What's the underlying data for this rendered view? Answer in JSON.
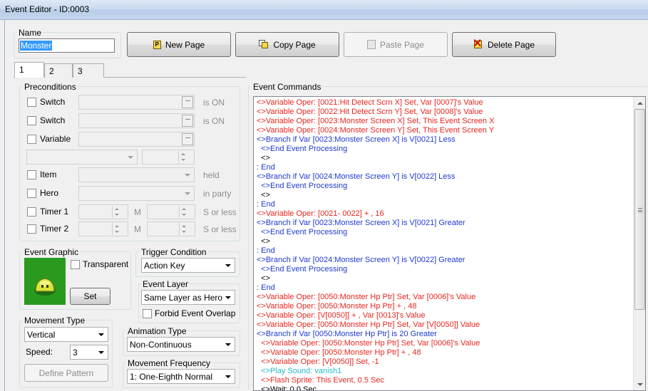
{
  "window": {
    "title": "Event Editor - ID:0003"
  },
  "name_group": {
    "label": "Name",
    "value": "Monster"
  },
  "toolbar": {
    "new_page": "New Page",
    "copy_page": "Copy Page",
    "paste_page": "Paste Page",
    "delete_page": "Delete Page"
  },
  "tabs": [
    "1",
    "2",
    "3"
  ],
  "preconditions": {
    "label": "Preconditions",
    "switch1": {
      "label": "Switch",
      "suffix": "is ON"
    },
    "switch2": {
      "label": "Switch",
      "suffix": "is ON"
    },
    "variable": {
      "label": "Variable"
    },
    "item": {
      "label": "Item",
      "suffix": "held"
    },
    "hero": {
      "label": "Hero",
      "suffix": "in party"
    },
    "timer1": {
      "label": "Timer 1",
      "m": "M",
      "suffix": "S or less"
    },
    "timer2": {
      "label": "Timer 2",
      "m": "M",
      "suffix": "S or less"
    }
  },
  "event_graphic": {
    "label": "Event Graphic",
    "transparent": "Transparent",
    "set": "Set"
  },
  "trigger": {
    "label": "Trigger Condition",
    "value": "Action Key"
  },
  "event_layer": {
    "label": "Event Layer",
    "value": "Same Layer as Hero",
    "forbid": "Forbid Event Overlap"
  },
  "movement_type": {
    "label": "Movement Type",
    "value": "Vertical",
    "speed_label": "Speed:",
    "speed_value": "3",
    "define": "Define Pattern"
  },
  "animation_type": {
    "label": "Animation Type",
    "value": "Non-Continuous"
  },
  "movement_frequency": {
    "label": "Movement Frequency",
    "value": "1: One-Eighth Normal"
  },
  "event_commands": {
    "label": "Event Commands",
    "colors": {
      "red": "#e8251e",
      "blue": "#1e3ad0",
      "teal": "#28b8c8"
    },
    "lines": [
      {
        "text": "<>Variable Oper: [0021:Hit Detect Scrn X] Set, Var [0007]'s Value",
        "color": "red"
      },
      {
        "text": "<>Variable Oper: [0022:Hit Detect Scrn Y] Set, Var [0008]'s Value",
        "color": "red"
      },
      {
        "text": "<>Variable Oper: [0023:Monster Screen X] Set, This Event Screen X",
        "color": "red"
      },
      {
        "text": "<>Variable Oper: [0024:Monster Screen Y] Set, This Event Screen Y",
        "color": "red"
      },
      {
        "text": "<>Branch if Var [0023:Monster Screen X] is V[0021] Less",
        "color": "blue"
      },
      {
        "text": "  <>End Event Processing",
        "color": "blue"
      },
      {
        "text": "  <>",
        "color": "black"
      },
      {
        "text": ": End",
        "color": "blue"
      },
      {
        "text": "<>Branch if Var [0024:Monster Screen Y] is V[0022] Less",
        "color": "blue"
      },
      {
        "text": "  <>End Event Processing",
        "color": "blue"
      },
      {
        "text": "  <>",
        "color": "black"
      },
      {
        "text": ": End",
        "color": "blue"
      },
      {
        "text": "<>Variable Oper: [0021- 0022] + , 16",
        "color": "red"
      },
      {
        "text": "<>Branch if Var [0023:Monster Screen X] is V[0021] Greater",
        "color": "blue"
      },
      {
        "text": "  <>End Event Processing",
        "color": "blue"
      },
      {
        "text": "  <>",
        "color": "black"
      },
      {
        "text": ": End",
        "color": "blue"
      },
      {
        "text": "<>Branch if Var [0024:Monster Screen Y] is V[0022] Greater",
        "color": "blue"
      },
      {
        "text": "  <>End Event Processing",
        "color": "blue"
      },
      {
        "text": "  <>",
        "color": "black"
      },
      {
        "text": ": End",
        "color": "blue"
      },
      {
        "text": "<>Variable Oper: [0050:Monster Hp Ptr] Set, Var [0006]'s Value",
        "color": "red"
      },
      {
        "text": "<>Variable Oper: [0050:Monster Hp Ptr] + , 48",
        "color": "red"
      },
      {
        "text": "<>Variable Oper: [V[0050]] + , Var [0013]'s Value",
        "color": "red"
      },
      {
        "text": "<>Variable Oper: [0050:Monster Hp Ptr] Set, Var [V[0050]] Value",
        "color": "red"
      },
      {
        "text": "<>Branch if Var [0050:Monster Hp Ptr] is 20 Greater",
        "color": "blue"
      },
      {
        "text": "  <>Variable Oper: [0050:Monster Hp Ptr] Set, Var [0006]'s Value",
        "color": "red"
      },
      {
        "text": "  <>Variable Oper: [0050:Monster Hp Ptr] + , 48",
        "color": "red"
      },
      {
        "text": "  <>Variable Oper: [V[0050]] Set, -1",
        "color": "red"
      },
      {
        "text": "  <>Play Sound: vanish1",
        "color": "teal"
      },
      {
        "text": "  <>Flash Sprite: This Event, 0.5 Sec",
        "color": "red"
      },
      {
        "text": "  <>Wait: 0.0 Sec",
        "color": "black"
      }
    ]
  }
}
